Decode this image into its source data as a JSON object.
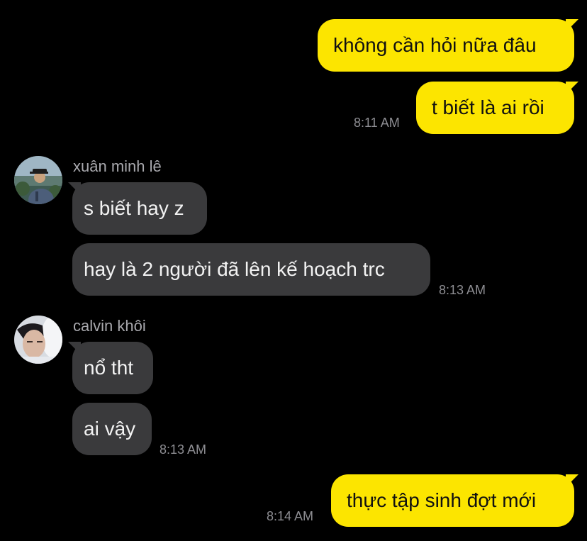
{
  "messages": {
    "out1": "không cần hỏi nữa đâu",
    "out2": "t biết là ai rồi",
    "out3": "thực tập sinh đợt mới",
    "in1": "s biết hay z",
    "in2": "hay là 2 người đã lên kế hoạch trc",
    "in3": "nổ tht",
    "in4": "ai vậy"
  },
  "times": {
    "t1": "8:11 AM",
    "t2": "8:13 AM",
    "t3": "8:13 AM",
    "t4": "8:14 AM"
  },
  "senders": {
    "s1": "xuân minh lê",
    "s2": "calvin khôi"
  },
  "icons": {
    "avatar1": "user-avatar-photo",
    "avatar2": "user-avatar-photo"
  },
  "colors": {
    "outgoing_bubble": "#FCE500",
    "incoming_bubble": "#3A3A3C",
    "background": "#000000",
    "timestamp": "#8E8E93"
  }
}
